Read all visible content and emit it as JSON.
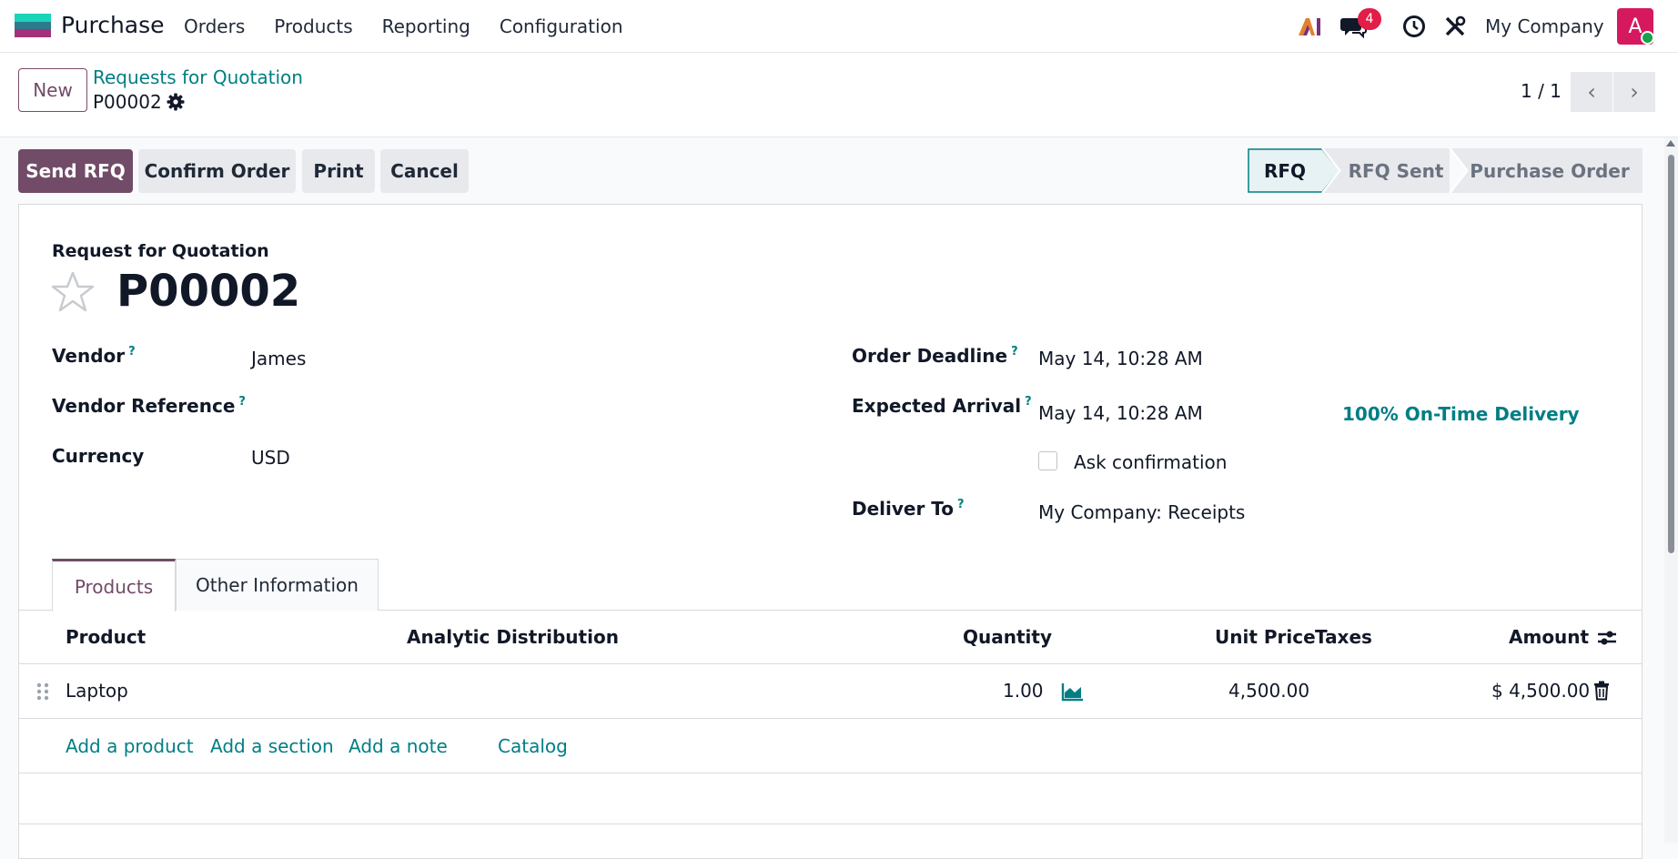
{
  "navbar": {
    "app_name": "Purchase",
    "menu": [
      "Orders",
      "Products",
      "Reporting",
      "Configuration"
    ],
    "messages_badge": "4",
    "company": "My Company",
    "avatar_letter": "A",
    "icons": [
      "ai-icon",
      "chat-icon",
      "clock-icon",
      "tools-icon"
    ]
  },
  "control_panel": {
    "new_label": "New",
    "breadcrumb": "Requests for Quotation",
    "record": "P00002",
    "pager": "1 / 1"
  },
  "actions": {
    "send_rfq": "Send RFQ",
    "confirm": "Confirm Order",
    "print": "Print",
    "cancel": "Cancel"
  },
  "statusbar": [
    "RFQ",
    "RFQ Sent",
    "Purchase Order"
  ],
  "form": {
    "heading": "Request for Quotation",
    "title": "P00002",
    "vendor_label": "Vendor",
    "vendor": "James",
    "vendor_ref_label": "Vendor Reference",
    "currency_label": "Currency",
    "currency": "USD",
    "deadline_label": "Order Deadline",
    "deadline": "May 14, 10:28 AM",
    "arrival_label": "Expected Arrival",
    "arrival": "May 14, 10:28 AM",
    "on_time": "100% On-Time Delivery",
    "ask_confirmation": "Ask confirmation",
    "deliver_label": "Deliver To",
    "deliver": "My Company: Receipts",
    "help_mark": "?"
  },
  "tabs": [
    "Products",
    "Other Information"
  ],
  "lines": {
    "headers": {
      "product": "Product",
      "analytic": "Analytic Distribution",
      "quantity": "Quantity",
      "unit_price": "Unit Price",
      "taxes": "Taxes",
      "amount": "Amount"
    },
    "rows": [
      {
        "product": "Laptop",
        "quantity": "1.00",
        "unit_price": "4,500.00",
        "amount": "$ 4,500.00"
      }
    ],
    "add_product": "Add a product",
    "add_section": "Add a section",
    "add_note": "Add a note",
    "catalog": "Catalog"
  },
  "colors": {
    "brand": "#714b67",
    "accent": "#017e84",
    "badge": "#e11d48"
  }
}
